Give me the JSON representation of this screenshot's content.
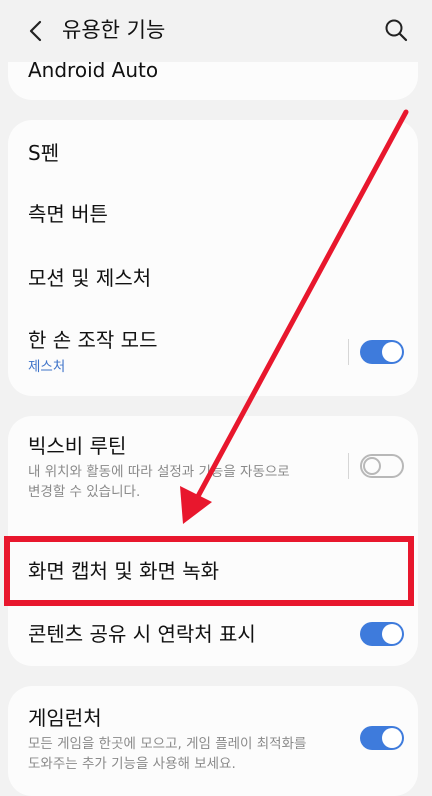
{
  "header": {
    "title": "유용한 기능",
    "back_icon": "chevron-left-icon",
    "search_icon": "search-icon"
  },
  "top_card": {
    "item_label": "Android Auto"
  },
  "card1": {
    "items": [
      {
        "label": "S펜"
      },
      {
        "label": "측면 버튼"
      },
      {
        "label": "모션 및 제스처"
      },
      {
        "label": "한 손 조작 모드",
        "sublabel": "제스처",
        "toggle": true
      }
    ]
  },
  "card2": {
    "items": [
      {
        "label": "빅스비 루틴",
        "description_line1": "내 위치와 활동에 따라 설정과 기능을 자동으로",
        "description_line2": "변경할 수 있습니다.",
        "toggle": false
      },
      {
        "label": "화면 캡처 및 화면 녹화"
      },
      {
        "label": "콘텐츠 공유 시 연락처 표시",
        "toggle": true
      }
    ]
  },
  "card3": {
    "items": [
      {
        "label": "게임런처",
        "description_line1": "모든 게임을 한곳에 모으고, 게임 플레이 최적화를",
        "description_line2": "도와주는 추가 기능을 사용해 보세요.",
        "toggle": true
      }
    ]
  },
  "colors": {
    "accent": "#3e7bdc",
    "annotation_red": "#e8172d",
    "background": "#f2f2f2",
    "card": "#fcfcfc"
  }
}
